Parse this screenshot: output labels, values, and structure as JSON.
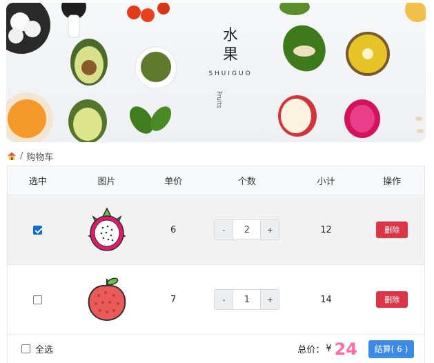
{
  "banner": {
    "title_line1": "水",
    "title_line2": "果",
    "subtitle_en": "SHUIGUO",
    "vertical_text": "Fruits"
  },
  "breadcrumb": {
    "home_icon": "home-icon",
    "separator": "/",
    "current": "购物车"
  },
  "table": {
    "headers": [
      "选中",
      "图片",
      "单价",
      "个数",
      "小计",
      "操作"
    ],
    "rows": [
      {
        "checked": true,
        "image": "dragon-fruit-icon",
        "price": "6",
        "minus": "-",
        "count": "2",
        "plus": "+",
        "subtotal": "12",
        "action": "删除"
      },
      {
        "checked": false,
        "image": "lychee-icon",
        "price": "7",
        "minus": "-",
        "count": "1",
        "plus": "+",
        "subtotal": "14",
        "action": "删除"
      }
    ]
  },
  "footer": {
    "select_all_label": "全选",
    "select_all_checked": false,
    "total_label": "总价：",
    "currency": "¥",
    "total_value": "24",
    "checkout_label": "结算( 6 )"
  },
  "colors": {
    "delete": "#dc3545",
    "checkout": "#3d8ae6",
    "total": "#ff6aa8",
    "checkbox": "#0a6cd4"
  }
}
